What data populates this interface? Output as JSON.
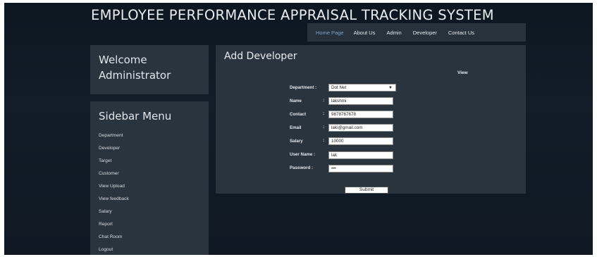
{
  "app": {
    "title": "EMPLOYEE PERFORMANCE APPRAISAL TRACKING SYSTEM"
  },
  "topnav": [
    {
      "label": "Home Page",
      "active": true
    },
    {
      "label": "About Us",
      "active": false
    },
    {
      "label": "Admin",
      "active": false
    },
    {
      "label": "Developer",
      "active": false
    },
    {
      "label": "Contact Us",
      "active": false
    }
  ],
  "welcome": {
    "text": "Welcome Administrator"
  },
  "sidebar": {
    "title": "Sidebar Menu",
    "items": [
      {
        "label": "Department"
      },
      {
        "label": "Developer"
      },
      {
        "label": "Target"
      },
      {
        "label": "Customer"
      },
      {
        "label": "View Upload"
      },
      {
        "label": "View feedback"
      },
      {
        "label": "Salary"
      },
      {
        "label": "Report"
      },
      {
        "label": "Chat Room"
      },
      {
        "label": "Logout"
      }
    ]
  },
  "main": {
    "title": "Add Developer",
    "view_link": "View",
    "form": {
      "department": {
        "label": "Department :",
        "value": "Dot Net"
      },
      "name": {
        "label": "Name",
        "value": "lakshmi"
      },
      "contact": {
        "label": "Contact",
        "value": "9878767678"
      },
      "email": {
        "label": "Email",
        "value": "laki@gmail.com"
      },
      "salary": {
        "label": "Salary",
        "value": "10000"
      },
      "username": {
        "label": "User Name :",
        "value": "lak"
      },
      "password": {
        "label": "Password :",
        "value": "•••"
      },
      "colon": ":",
      "submit_label": "Submit"
    }
  },
  "colors": {
    "page_bg": "#0f1823",
    "panel_bg": "#2a343f",
    "nav_bg": "#27323d",
    "active_nav": "#7da2c8",
    "text": "#e6e9ec"
  }
}
